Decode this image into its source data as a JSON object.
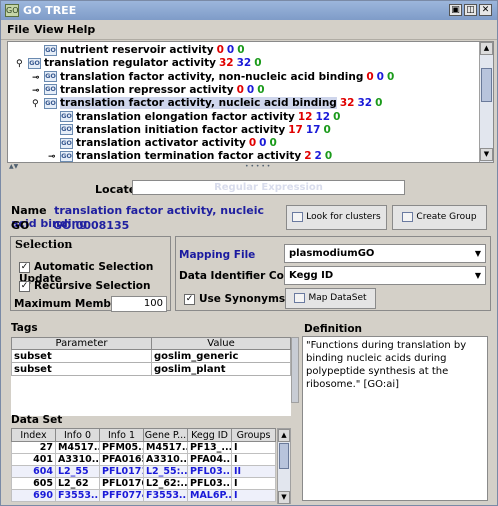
{
  "window": {
    "title": "GO TREE",
    "controls": [
      "▣",
      "◫",
      "✕"
    ]
  },
  "menu": [
    "File",
    "View",
    "Help"
  ],
  "tree": {
    "rows": [
      {
        "label": "nutrient reservoir activity",
        "c1": "0",
        "c2": "0",
        "c3": "0",
        "indent": 1,
        "toggle": "",
        "selected": false
      },
      {
        "label": "translation regulator activity",
        "c1": "32",
        "c2": "32",
        "c3": "0",
        "indent": 0,
        "toggle": "open",
        "selected": false
      },
      {
        "label": "translation factor activity, non-nucleic acid binding",
        "c1": "0",
        "c2": "0",
        "c3": "0",
        "indent": 1,
        "toggle": "closed",
        "selected": false
      },
      {
        "label": "translation repressor activity",
        "c1": "0",
        "c2": "0",
        "c3": "0",
        "indent": 1,
        "toggle": "closed",
        "selected": false
      },
      {
        "label": "translation factor activity, nucleic acid binding",
        "c1": "32",
        "c2": "32",
        "c3": "0",
        "indent": 1,
        "toggle": "open",
        "selected": true
      },
      {
        "label": "translation elongation factor activity",
        "c1": "12",
        "c2": "12",
        "c3": "0",
        "indent": 2,
        "toggle": "",
        "selected": false
      },
      {
        "label": "translation initiation factor activity",
        "c1": "17",
        "c2": "17",
        "c3": "0",
        "indent": 2,
        "toggle": "",
        "selected": false
      },
      {
        "label": "translation activator activity",
        "c1": "0",
        "c2": "0",
        "c3": "0",
        "indent": 2,
        "toggle": "",
        "selected": false
      },
      {
        "label": "translation termination factor activity",
        "c1": "2",
        "c2": "2",
        "c3": "0",
        "indent": 2,
        "toggle": "closed",
        "selected": false
      }
    ]
  },
  "locate": {
    "label": "Locate",
    "placeholder": "Regular Expression"
  },
  "name": {
    "label": "Name",
    "value": "translation factor activity, nucleic acid binding"
  },
  "go": {
    "label": "GO",
    "value": "GO:0008135"
  },
  "buttons": {
    "look_for_clusters": "Look for clusters",
    "create_group": "Create Group",
    "map_dataset": "Map DataSet"
  },
  "selection": {
    "title": "Selection",
    "auto_update": "Automatic Selection Update",
    "recursive": "Recursive Selection",
    "max_members_label": "Maximum Members",
    "max_members_value": "100"
  },
  "mapping": {
    "file_label": "Mapping File",
    "file_value": "plasmodiumGO",
    "column_label": "Data Identifier Column",
    "column_value": "Kegg ID",
    "synonyms_label": "Use Synonyms"
  },
  "tags": {
    "title": "Tags",
    "headers": [
      "Parameter",
      "Value"
    ],
    "rows": [
      [
        "subset",
        "goslim_generic"
      ],
      [
        "subset",
        "goslim_plant"
      ]
    ]
  },
  "definition": {
    "title": "Definition",
    "text": "\"Functions during translation by binding nucleic acids during polypeptide synthesis at the ribosome.\" [GO:ai]"
  },
  "dataset": {
    "title": "Data Set",
    "headers": [
      "Index",
      "Info 0",
      "Info 1",
      "Gene P...",
      "Kegg ID",
      "Groups"
    ],
    "rows": [
      {
        "cells": [
          "27",
          "M4517...",
          "PFM05...",
          "M4517...",
          "PF13_...",
          "I"
        ],
        "selected": false
      },
      {
        "cells": [
          "401",
          "A3310...",
          "PFA0165",
          "A3310...",
          "PFA04...",
          "I"
        ],
        "selected": false
      },
      {
        "cells": [
          "604",
          "L2_55",
          "PFL0171",
          "L2_55:...",
          "PFL03...",
          "II"
        ],
        "selected": true
      },
      {
        "cells": [
          "605",
          "L2_62",
          "PFL0176",
          "L2_62:...",
          "PFL03...",
          "I"
        ],
        "selected": false
      },
      {
        "cells": [
          "690",
          "F3553...",
          "PFF0774",
          "F3553...",
          "MAL6P...",
          "I"
        ],
        "selected": true
      }
    ]
  },
  "colors": {
    "count_red": "#e00000",
    "count_blue": "#1a1ad8",
    "count_green": "#1a9a1a",
    "selection_highlight": "#cfd6ec"
  }
}
